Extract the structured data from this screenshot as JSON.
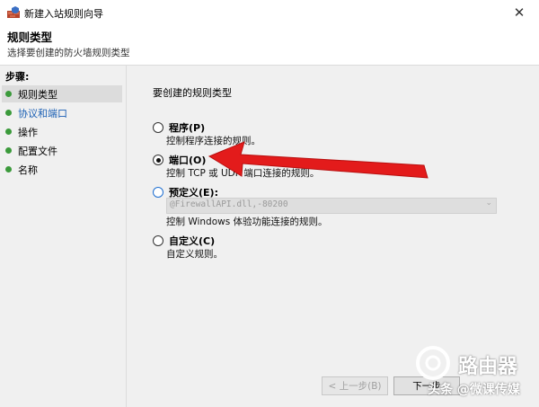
{
  "window": {
    "title": "新建入站规则向导",
    "close_glyph": "✕"
  },
  "header": {
    "title": "规则类型",
    "subtitle": "选择要创建的防火墙规则类型"
  },
  "sidebar": {
    "steps_label": "步骤:",
    "items": [
      {
        "label": "规则类型",
        "active": true
      },
      {
        "label": "协议和端口",
        "link": true
      },
      {
        "label": "操作"
      },
      {
        "label": "配置文件"
      },
      {
        "label": "名称"
      }
    ]
  },
  "main": {
    "prompt": "要创建的规则类型",
    "options": [
      {
        "title": "程序(P)",
        "desc": "控制程序连接的规则。",
        "selected": false
      },
      {
        "title": "端口(O)",
        "desc": "控制 TCP 或 UDP 端口连接的规则。",
        "selected": true
      },
      {
        "title": "预定义(E):",
        "desc": "控制 Windows 体验功能连接的规则。",
        "selected": false,
        "select_value": "@FirewallAPI.dll,-80200"
      },
      {
        "title": "自定义(C)",
        "desc": "自定义规则。",
        "selected": false
      }
    ]
  },
  "buttons": {
    "back": "< 上一步(B)",
    "next": "下一步"
  },
  "watermark": {
    "brand": "路由器",
    "source": "头条 @微课传媒"
  },
  "colors": {
    "arrow": "#e31b1b",
    "step_dot": "#3b9a3b",
    "link": "#1a5fb4"
  }
}
